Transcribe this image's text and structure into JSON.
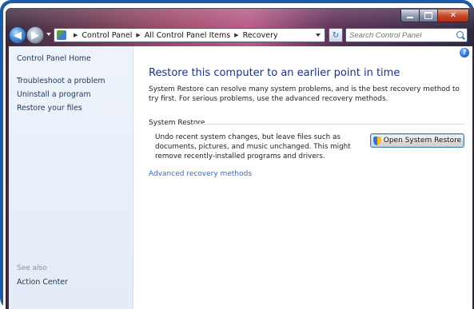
{
  "window": {
    "controls": {
      "minimize": "minimize",
      "maximize": "maximize",
      "close": "close"
    }
  },
  "address_bar": {
    "breadcrumbs": [
      "Control Panel",
      "All Control Panel Items",
      "Recovery"
    ],
    "search_placeholder": "Search Control Panel"
  },
  "sidebar": {
    "home": "Control Panel Home",
    "links": [
      "Troubleshoot a problem",
      "Uninstall a program",
      "Restore your files"
    ],
    "see_also_label": "See also",
    "see_also_links": [
      "Action Center"
    ]
  },
  "main": {
    "title": "Restore this computer to an earlier point in time",
    "description": "System Restore can resolve many system problems, and is the best recovery method to try first. For serious problems, use the advanced recovery methods.",
    "section_label": "System Restore",
    "section_text": "Undo recent system changes, but leave files such as documents, pictures, and music unchanged. This might remove recently-installed programs and drivers.",
    "open_button": "Open System Restore",
    "advanced_link": "Advanced recovery methods"
  },
  "colors": {
    "title_blue": "#1e3287",
    "link_blue": "#2f6bd6",
    "sidebar_bg": "#e4ecf8",
    "frame_blue": "#1b5aa6"
  },
  "icons": {
    "back": "back-arrow-icon",
    "forward": "forward-arrow-icon",
    "control_panel": "control-panel-icon",
    "refresh": "refresh-icon",
    "search": "search-icon",
    "help": "help-icon",
    "shield": "uac-shield-icon"
  }
}
